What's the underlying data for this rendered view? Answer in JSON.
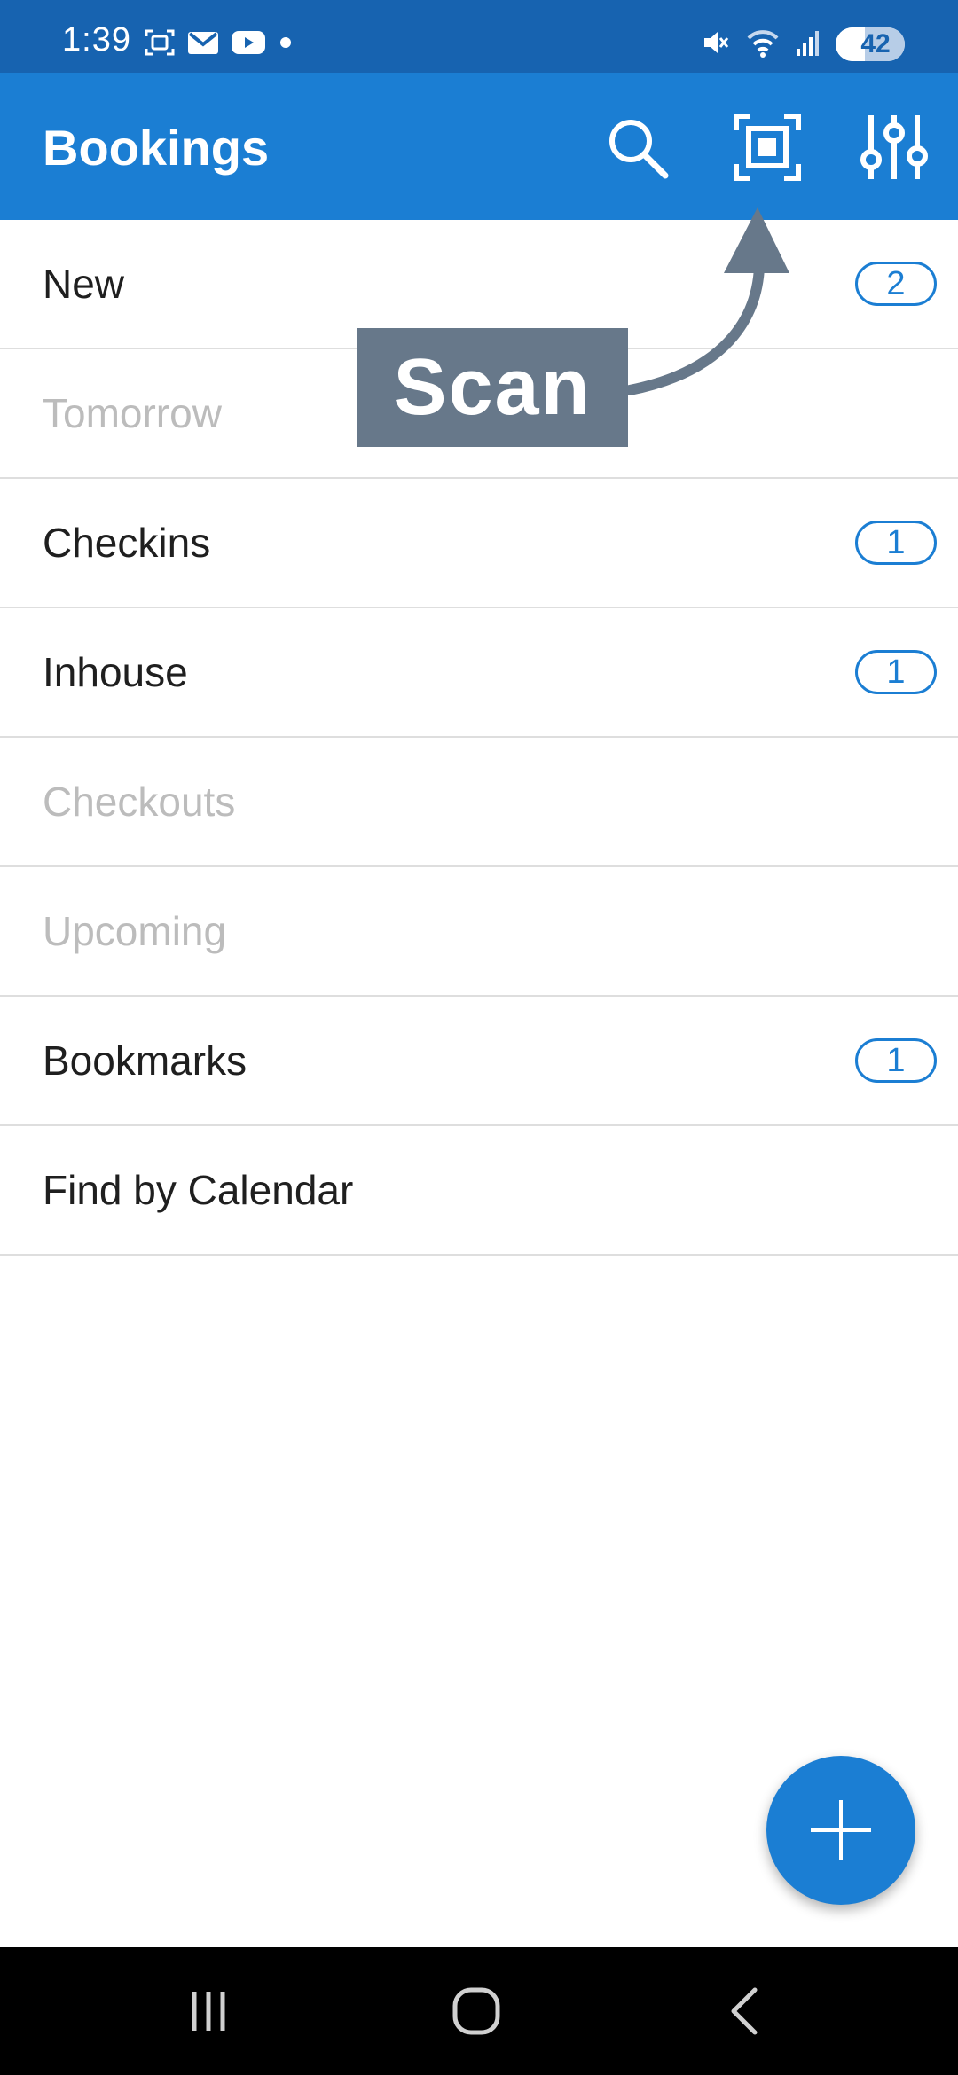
{
  "status_bar": {
    "time": "1:39",
    "battery_level": "42",
    "icons": [
      "screenshot-icon",
      "gmail-icon",
      "youtube-icon",
      "dot-icon",
      "mute-icon",
      "wifi-icon",
      "signal-icon",
      "battery-icon"
    ]
  },
  "app_bar": {
    "title": "Bookings",
    "actions": [
      "search-icon",
      "scan-icon",
      "filter-sliders-icon"
    ]
  },
  "tooltip": {
    "label": "Scan"
  },
  "list": {
    "items": [
      {
        "label": "New",
        "count": "2",
        "muted": false
      },
      {
        "label": "Tomorrow",
        "count": "",
        "muted": true
      },
      {
        "label": "Checkins",
        "count": "1",
        "muted": false
      },
      {
        "label": "Inhouse",
        "count": "1",
        "muted": false
      },
      {
        "label": "Checkouts",
        "count": "",
        "muted": true
      },
      {
        "label": "Upcoming",
        "count": "",
        "muted": true
      },
      {
        "label": "Bookmarks",
        "count": "1",
        "muted": false
      },
      {
        "label": "Find by Calendar",
        "count": "",
        "muted": false
      }
    ]
  },
  "fab": {
    "icon": "plus-icon"
  },
  "nav_bar": {
    "buttons": [
      "recents-icon",
      "home-icon",
      "back-icon"
    ]
  },
  "colors": {
    "status_bar": "#1763b0",
    "app_bar": "#1b7ed3",
    "accent": "#1b7ed3",
    "muted_text": "#bcbcbc",
    "tooltip_bg": "#67788a"
  }
}
